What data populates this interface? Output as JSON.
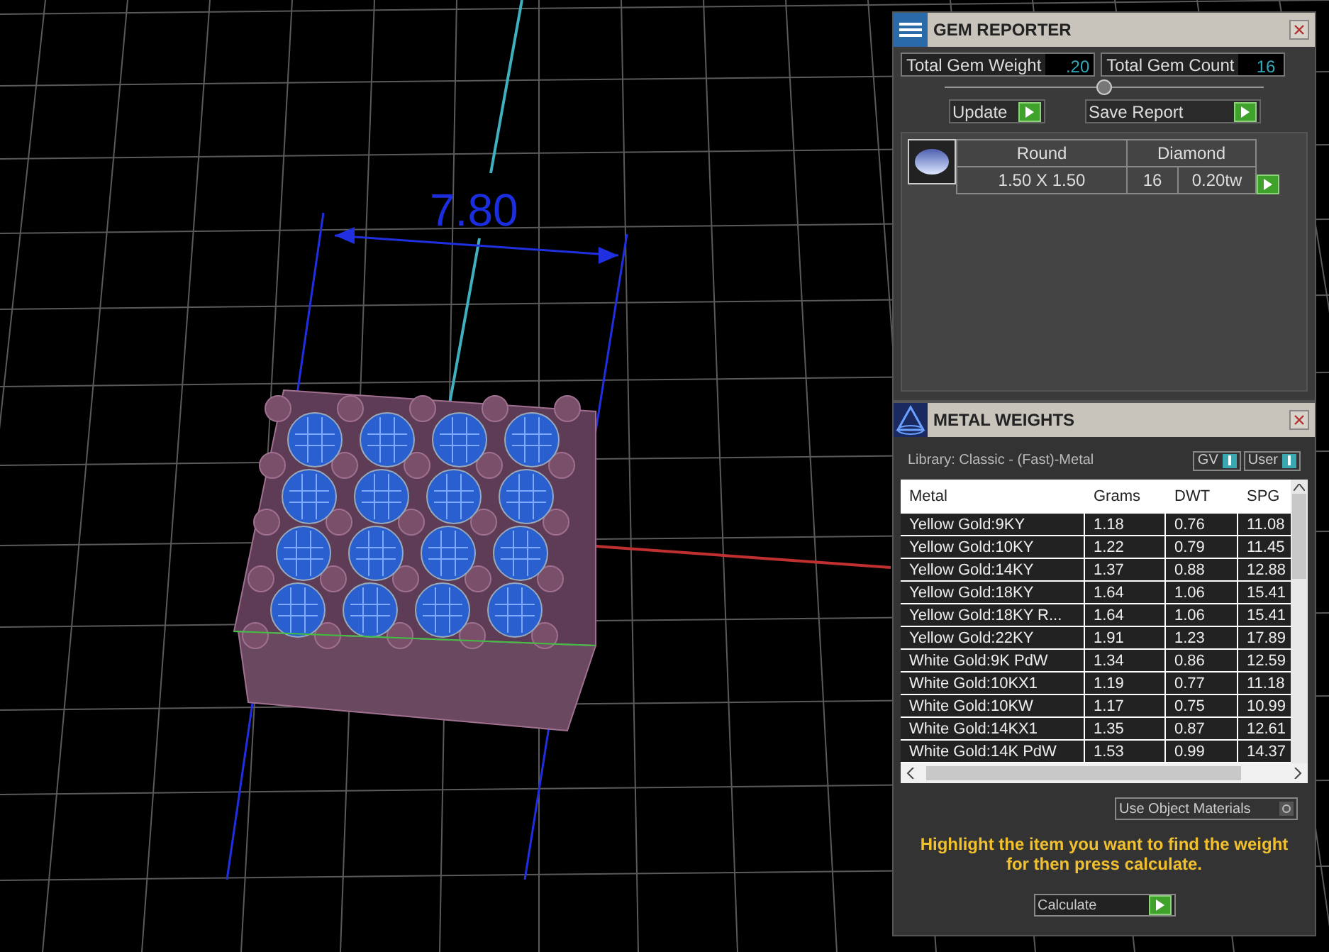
{
  "viewport": {
    "dimension": "7.80"
  },
  "gem_reporter": {
    "title": "GEM REPORTER",
    "total_gem_weight": {
      "label": "Total Gem Weight",
      "value": ".20"
    },
    "total_gem_count": {
      "label": "Total Gem Count",
      "value": "16"
    },
    "buttons": [
      {
        "label": "Update"
      },
      {
        "label": "Save Report"
      }
    ],
    "gems": [
      {
        "shape": "Round",
        "size": "1.50 X 1.50",
        "material": "Diamond",
        "count": "16",
        "weight": "0.20tw"
      }
    ]
  },
  "metal_weights": {
    "title": "METAL WEIGHTS",
    "library": "Library: Classic - (Fast)-Metal",
    "toggles": [
      {
        "label": "GV",
        "on": true
      },
      {
        "label": "User",
        "on": true
      }
    ],
    "columns": [
      "Metal",
      "Grams",
      "DWT",
      "SPG"
    ],
    "rows": [
      [
        "Yellow Gold:9KY",
        "1.18",
        "0.76",
        "11.08"
      ],
      [
        "Yellow Gold:10KY",
        "1.22",
        "0.79",
        "11.45"
      ],
      [
        "Yellow Gold:14KY",
        "1.37",
        "0.88",
        "12.88"
      ],
      [
        "Yellow Gold:18KY",
        "1.64",
        "1.06",
        "15.41"
      ],
      [
        "Yellow Gold:18KY R...",
        "1.64",
        "1.06",
        "15.41"
      ],
      [
        "Yellow Gold:22KY",
        "1.91",
        "1.23",
        "17.89"
      ],
      [
        "White Gold:9K PdW",
        "1.34",
        "0.86",
        "12.59"
      ],
      [
        "White Gold:10KX1",
        "1.19",
        "0.77",
        "11.18"
      ],
      [
        "White Gold:10KW",
        "1.17",
        "0.75",
        "10.99"
      ],
      [
        "White Gold:14KX1",
        "1.35",
        "0.87",
        "12.61"
      ],
      [
        "White Gold:14K PdW",
        "1.53",
        "0.99",
        "14.37"
      ]
    ],
    "use_object_materials": {
      "label": "Use Object Materials",
      "on": false
    },
    "hint": "Highlight the item you want to find the weight for then press calculate.",
    "calculate": "Calculate"
  }
}
